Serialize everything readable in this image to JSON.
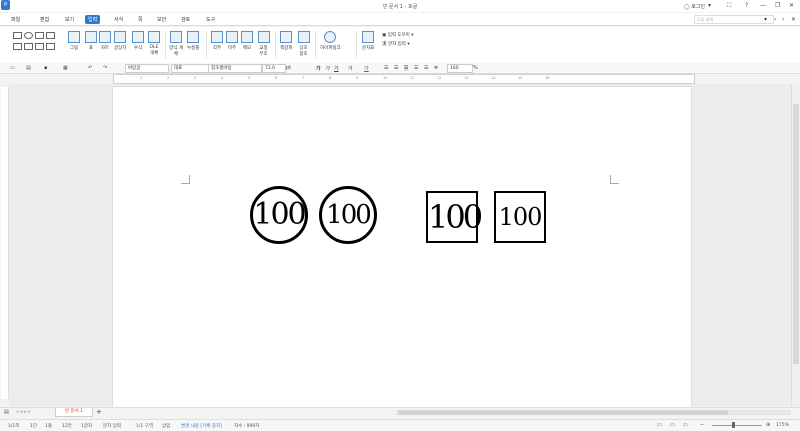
{
  "window": {
    "title": "빈 문서 1 - 호글",
    "login_label": "로그인",
    "controls": [
      "▾",
      "⛶",
      "?",
      "—",
      "❐",
      "✕"
    ]
  },
  "menu": {
    "items": [
      {
        "label": "파일"
      },
      {
        "label": "편집"
      },
      {
        "label": "보기"
      },
      {
        "label": "입력",
        "active": true
      },
      {
        "label": "서식"
      },
      {
        "label": "쪽"
      },
      {
        "label": "보안"
      },
      {
        "label": "검토"
      },
      {
        "label": "도구"
      }
    ],
    "help_search_placeholder": "도움 검색",
    "right_icons": [
      "▾",
      "‹",
      "›",
      "✕"
    ]
  },
  "ribbon": {
    "buttons": [
      "그림",
      "표",
      "차트",
      "글상자",
      "수식",
      "OLE 개체",
      "양식 개체",
      "누름틀",
      "각주",
      "미주",
      "메모",
      "교정 부호",
      "책갈피",
      "상호 참조",
      "하이퍼링크",
      "문자표"
    ],
    "side_items": [
      "입력 도우미",
      "한자 입력"
    ]
  },
  "format_bar": {
    "style": "바탕글",
    "lang": "대표",
    "font": "함초롬바탕",
    "size": "72.0",
    "unit": "pt",
    "glyphs": [
      "가",
      "가",
      "가",
      "가",
      "가"
    ],
    "line_spacing": "160",
    "line_spacing_unit": "%"
  },
  "ruler": {
    "ticks": [
      "1",
      "2",
      "3",
      "4",
      "5",
      "6",
      "7",
      "8",
      "9",
      "10",
      "11",
      "12",
      "13",
      "14",
      "15",
      "16"
    ]
  },
  "document": {
    "circled_numbers": [
      "100",
      "100"
    ],
    "boxed_numbers": [
      "100",
      "100"
    ]
  },
  "tabs": {
    "doc_tab": "빈 문서 1",
    "add": "+"
  },
  "status": {
    "items": [
      "1/1쪽",
      "1단",
      "1줄",
      "12칸",
      "1글자",
      "문자 입력",
      "1/1 구역",
      "삽입",
      "변경 내용 [기록 중지]",
      "자수 : 999자"
    ],
    "zoom": "175%"
  },
  "colors": {
    "accent": "#2b7bd1",
    "doc_tab_text": "#c0392b"
  }
}
